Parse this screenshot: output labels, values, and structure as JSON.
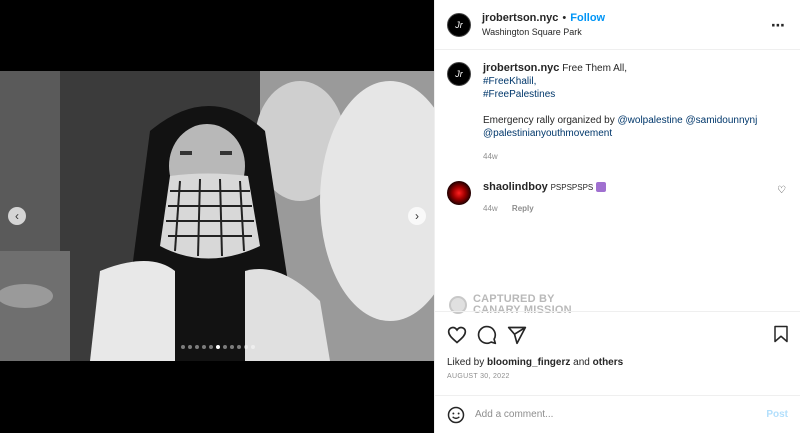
{
  "post": {
    "username": "jrobertson.nyc",
    "separator": "•",
    "follow_label": "Follow",
    "location": "Washington Square Park",
    "more_icon": "more-options-icon",
    "avatar_text": "Jr"
  },
  "media": {
    "prev_icon": "chevron-left-icon",
    "next_icon": "chevron-right-icon",
    "slide_count": 11,
    "active_slide": 6
  },
  "caption": {
    "username": "jrobertson.nyc",
    "text": "Free Them All,",
    "tag1": "#FreeKhalil,",
    "tag2": "#FreePalestinеs",
    "line2_prefix": "Emergency rally organized by",
    "mention1": "@wolpalestine",
    "mention2": "@samidounnynj",
    "mention3": "@palestinianyouthmovement",
    "age": "44w"
  },
  "comment": {
    "username": "shaolindboy",
    "text": "PSPSPSPS",
    "age": "44w",
    "reply_label": "Reply",
    "like_icon": "heart-icon"
  },
  "watermark": {
    "line1": "CAPTURED BY",
    "line2": "CANARY MISSION"
  },
  "actions": {
    "like_icon": "heart-icon",
    "comment_icon": "comment-icon",
    "share_icon": "share-icon",
    "save_icon": "bookmark-icon"
  },
  "likes": {
    "prefix": "Liked by",
    "user": "blooming_fingerz",
    "mid": "and",
    "others": "others"
  },
  "date": "AUGUST 30, 2022",
  "add_comment": {
    "placeholder": "Add a comment...",
    "post_label": "Post",
    "emoji_icon": "smiley-icon"
  },
  "colors": {
    "accent": "#0095f6",
    "link": "#00376b",
    "muted": "#8e8e8e"
  }
}
